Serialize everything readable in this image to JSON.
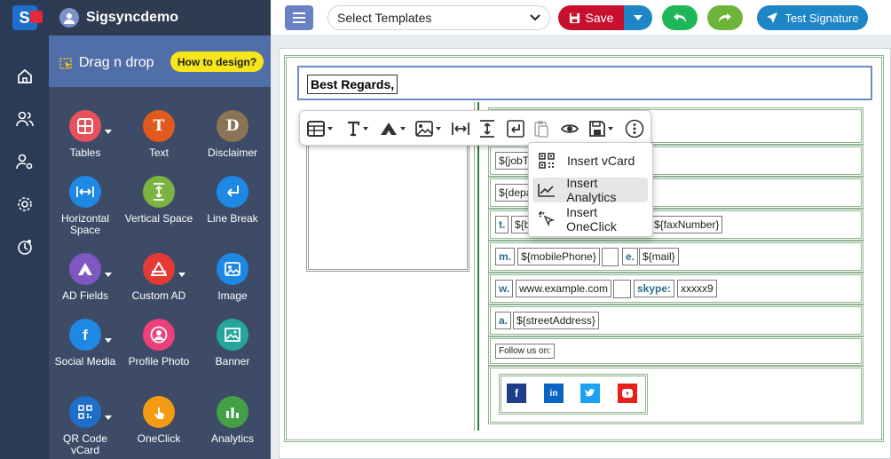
{
  "header": {
    "brand": "Sigsyncdemo",
    "select_templates": "Select Templates",
    "save_label": "Save",
    "test_label": "Test Signature"
  },
  "palette": {
    "title": "Drag n drop",
    "how_to": "How to design?",
    "tools": [
      {
        "label": "Tables",
        "icon": "table-icon",
        "color": "#e8505b"
      },
      {
        "label": "Text",
        "icon": "text-icon",
        "color": "#e05a1f",
        "glyph": "T"
      },
      {
        "label": "Disclaimer",
        "icon": "disclaimer-icon",
        "color": "#8b7355",
        "glyph": "D"
      },
      {
        "label": "Horizontal Space",
        "icon": "horizontal-space-icon",
        "color": "#1e88e5"
      },
      {
        "label": "Vertical Space",
        "icon": "vertical-space-icon",
        "color": "#7cb342"
      },
      {
        "label": "Line Break",
        "icon": "line-break-icon",
        "color": "#1e88e5"
      },
      {
        "label": "AD Fields",
        "icon": "ad-fields-icon",
        "color": "#7e57c2"
      },
      {
        "label": "Custom AD",
        "icon": "custom-ad-icon",
        "color": "#e53935"
      },
      {
        "label": "Image",
        "icon": "image-icon",
        "color": "#1e88e5"
      },
      {
        "label": "Social Media",
        "icon": "social-media-icon",
        "color": "#1e88e5"
      },
      {
        "label": "Profile Photo",
        "icon": "profile-photo-icon",
        "color": "#ec407a"
      },
      {
        "label": "Banner",
        "icon": "banner-icon",
        "color": "#26a69a"
      },
      {
        "label": "QR Code vCard",
        "icon": "qr-code-icon",
        "color": "#1e6fc9"
      },
      {
        "label": "OneClick",
        "icon": "oneclick-icon",
        "color": "#f39c12"
      },
      {
        "label": "Analytics",
        "icon": "analytics-icon",
        "color": "#43a047"
      }
    ]
  },
  "canvas": {
    "greeting": "Best Regards,",
    "fields": {
      "job": "${jobT",
      "dept": "${depa",
      "t_label": "t.",
      "t_val": "${b",
      "fax": "${faxNumber}",
      "m_label": "m.",
      "mobile": "${mobilePhone}",
      "e_label": "e.",
      "mail": "${mail}",
      "w_label": "w.",
      "web": "www.example.com",
      "skype_label": "skype:",
      "skype": "xxxxx9",
      "a_label": "a.",
      "street": "${streetAddress}",
      "follow": "Follow us on:"
    }
  },
  "insert_menu": {
    "items": [
      {
        "label": "Insert vCard",
        "icon": "qr-code-icon"
      },
      {
        "label": "Insert Analytics",
        "icon": "analytics-icon"
      },
      {
        "label": "Insert OneClick",
        "icon": "click-icon"
      }
    ]
  },
  "colors": {
    "sidebar": "#2b3a55",
    "palette": "#3d4b66",
    "accent_blue": "#1e85c6",
    "save_red": "#c8102e",
    "table_border": "#8fb48f"
  }
}
